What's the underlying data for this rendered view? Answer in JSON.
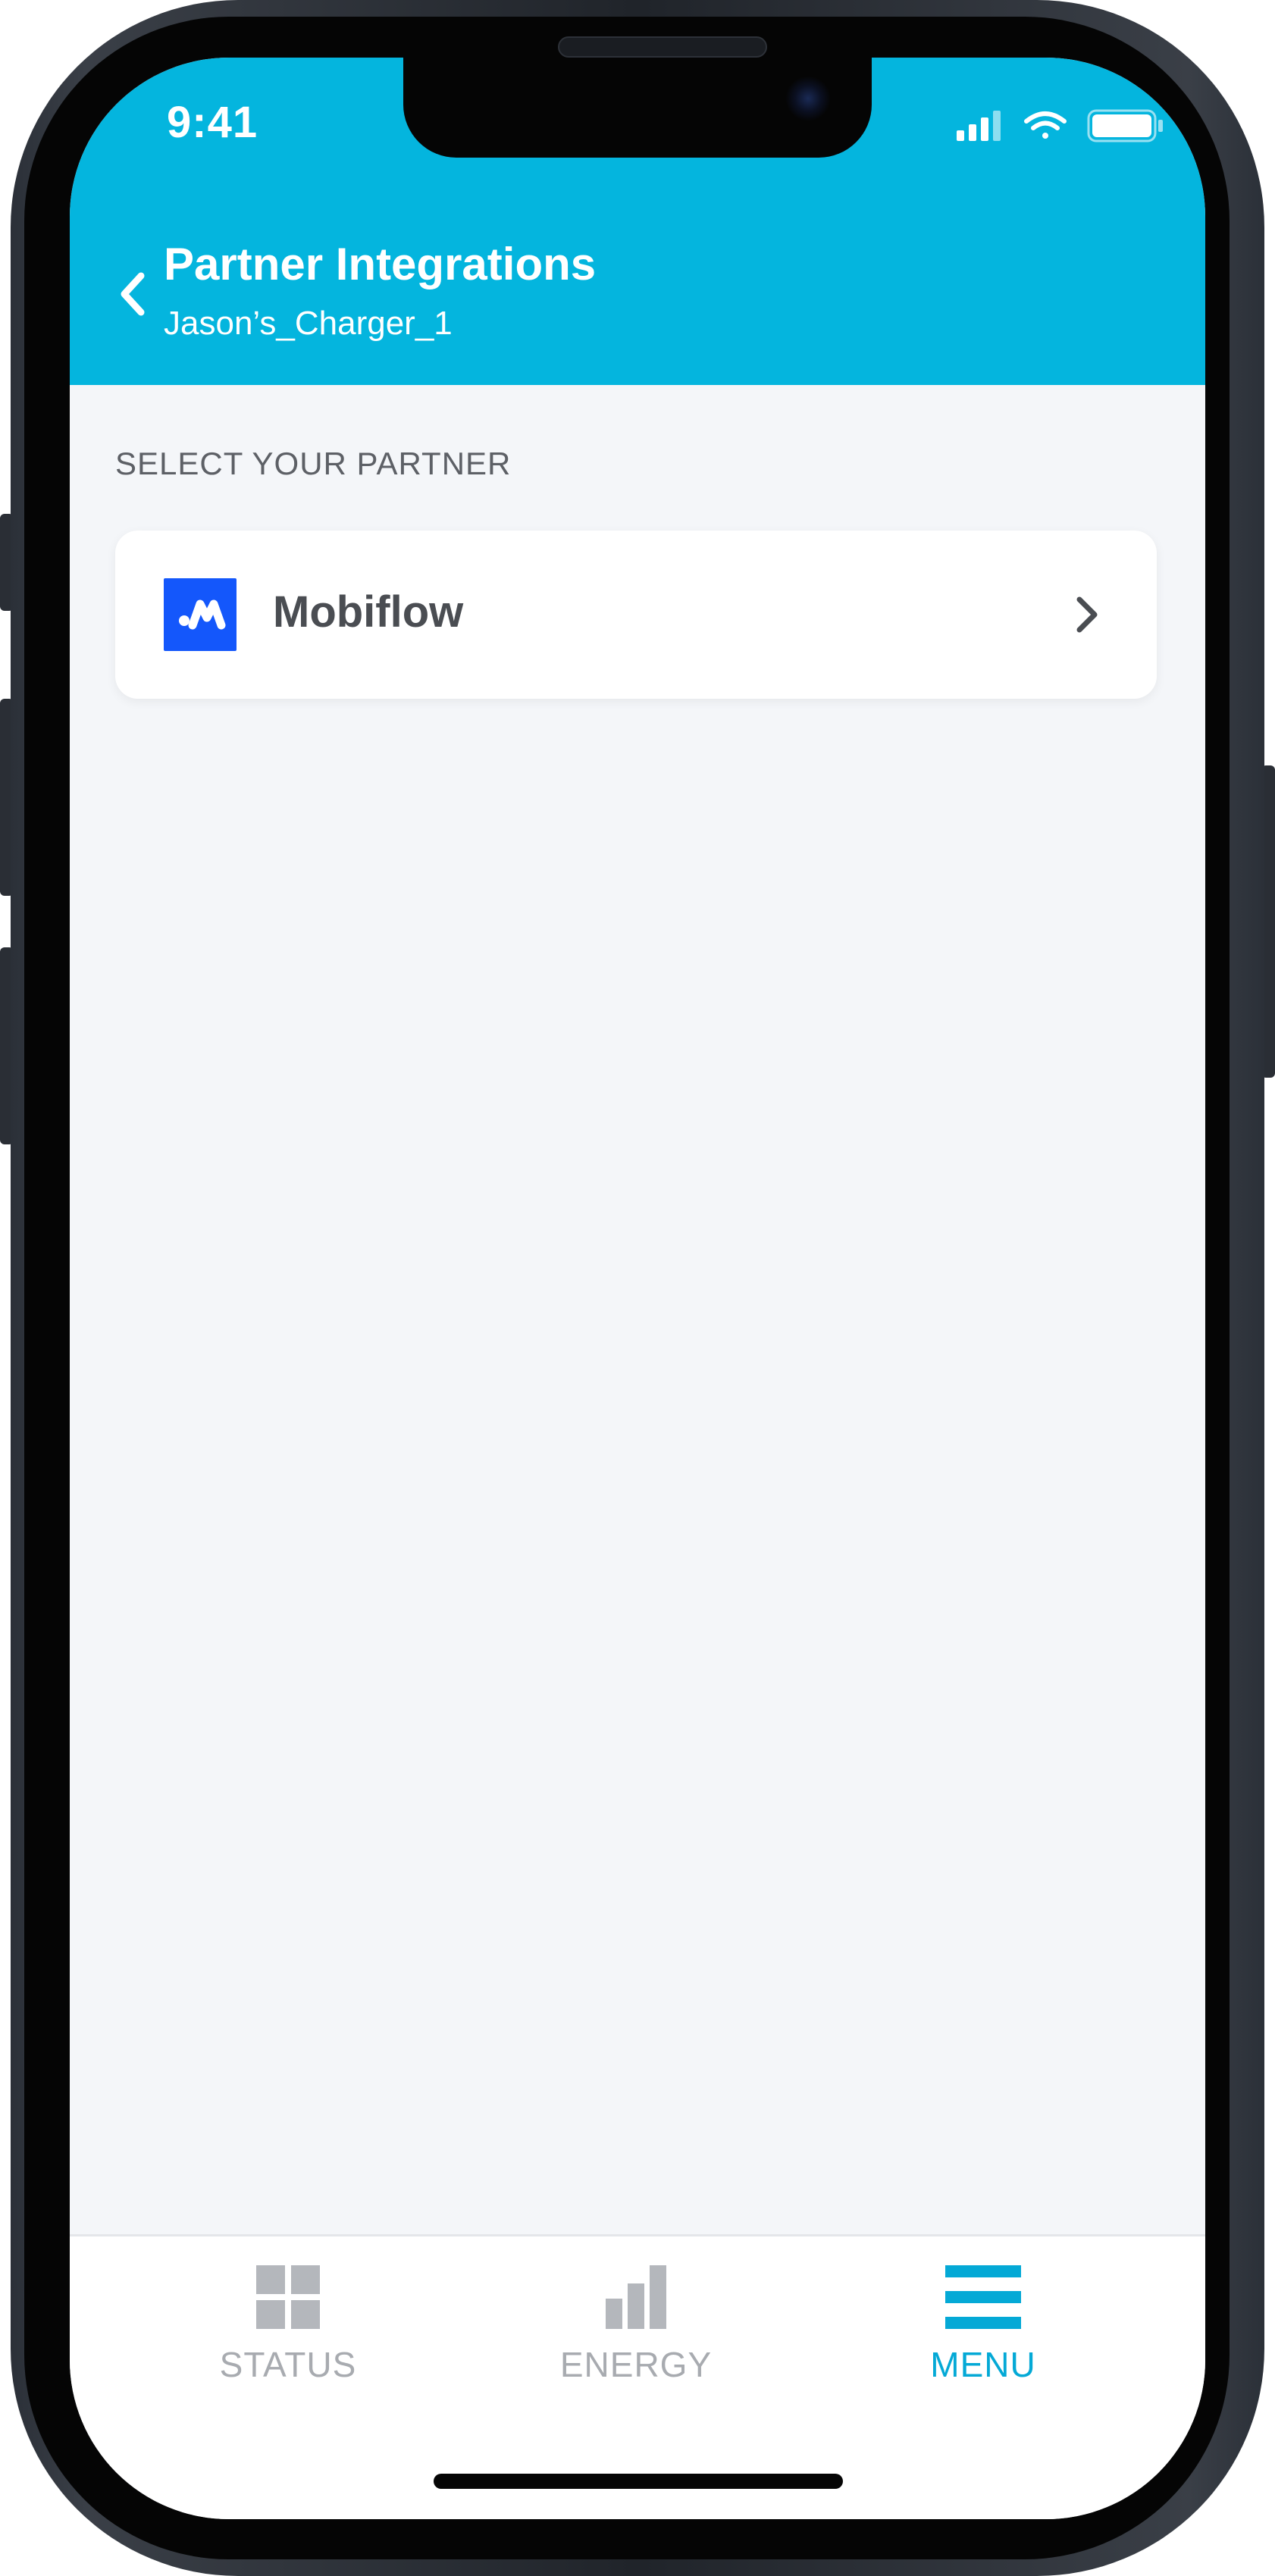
{
  "status_bar": {
    "time": "9:41"
  },
  "header": {
    "title": "Partner Integrations",
    "subtitle": "Jason’s_Charger_1",
    "back_icon": "chevron-left-icon"
  },
  "content": {
    "section_label": "SELECT YOUR PARTNER",
    "partners": [
      {
        "name": "Mobiflow",
        "logo_icon": "mobiflow-logo",
        "chevron_icon": "chevron-right-icon"
      }
    ]
  },
  "tabbar": {
    "tabs": [
      {
        "label": "STATUS",
        "icon": "grid-icon",
        "active": false
      },
      {
        "label": "ENERGY",
        "icon": "bar-chart-icon",
        "active": false
      },
      {
        "label": "MENU",
        "icon": "menu-icon",
        "active": true
      }
    ]
  },
  "colors": {
    "header_bg": "#04b5de",
    "active_tab": "#04a9d6",
    "inactive_tab": "#a8abb0",
    "page_bg": "#f4f6f9",
    "mobiflow_blue": "#1457fb"
  }
}
